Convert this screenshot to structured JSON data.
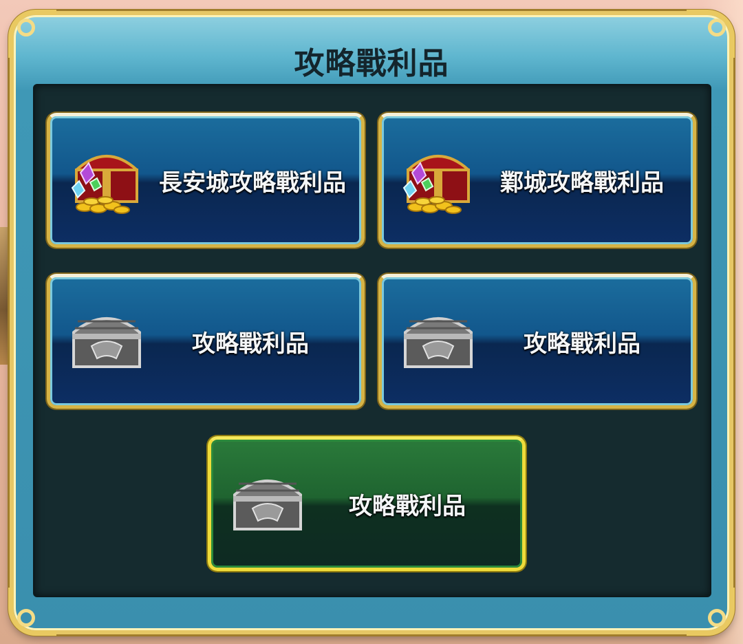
{
  "panel": {
    "title": "攻略戰利品"
  },
  "cards": [
    {
      "label": "長安城攻略戰利品",
      "icon": "gold-treasure-chest-icon",
      "style": "blue"
    },
    {
      "label": "鄴城攻略戰利品",
      "icon": "gold-treasure-chest-icon",
      "style": "blue"
    },
    {
      "label": "攻略戰利品",
      "icon": "silver-chest-icon",
      "style": "blue"
    },
    {
      "label": "攻略戰利品",
      "icon": "silver-chest-icon",
      "style": "blue"
    },
    {
      "label": "攻略戰利品",
      "icon": "silver-chest-icon",
      "style": "green-selected"
    }
  ],
  "colors": {
    "frame_gold": "#e6c766",
    "frame_teal": "#3f98b6",
    "inner_bg": "#152b2f",
    "card_blue": "#12578c",
    "card_green": "#1f6430"
  }
}
